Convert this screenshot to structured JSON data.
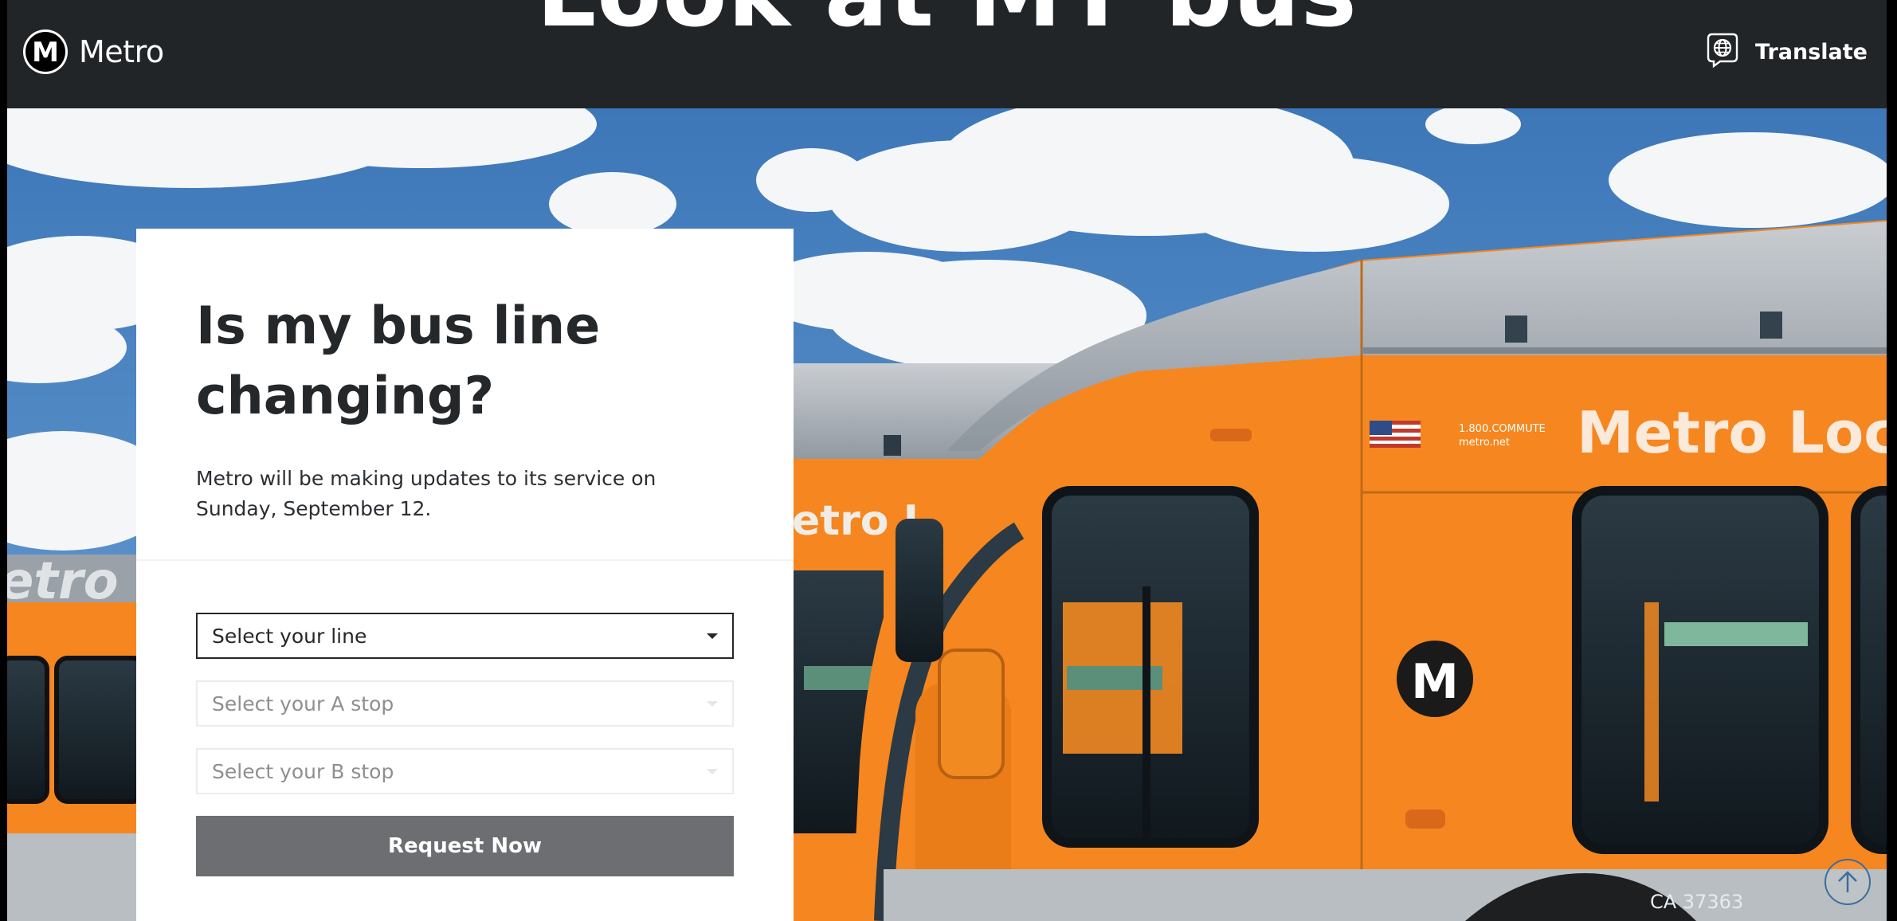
{
  "header": {
    "ghost_title": "Look at MY bus",
    "logo_letter": "M",
    "logo_text": "Metro",
    "translate_label": "Translate"
  },
  "hero": {
    "bus_front_text": "Metro Loca",
    "bus_back_text": "etro L",
    "bus_left_text": "etro",
    "bus_phone": "1.800.COMMUTE",
    "bus_web": "metro.net",
    "bus_badge_letter": "M",
    "plate": "CA 37363"
  },
  "form": {
    "heading_line1": "Is my bus line",
    "heading_line2": "changing?",
    "description": "Metro will be making updates to its service on Sunday, September 12.",
    "line_select": "Select your line",
    "stop_a_select": "Select your A stop",
    "stop_b_select": "Select your B stop",
    "submit_label": "Request Now"
  },
  "colors": {
    "header_bg": "#212528",
    "bus_orange": "#f6861f",
    "button_bg": "#6d6e71",
    "scroll_ring": "#3b6d9d"
  },
  "icons": [
    "metro-logo-icon",
    "translate-icon",
    "chevron-down-icon",
    "scroll-to-top-icon"
  ]
}
